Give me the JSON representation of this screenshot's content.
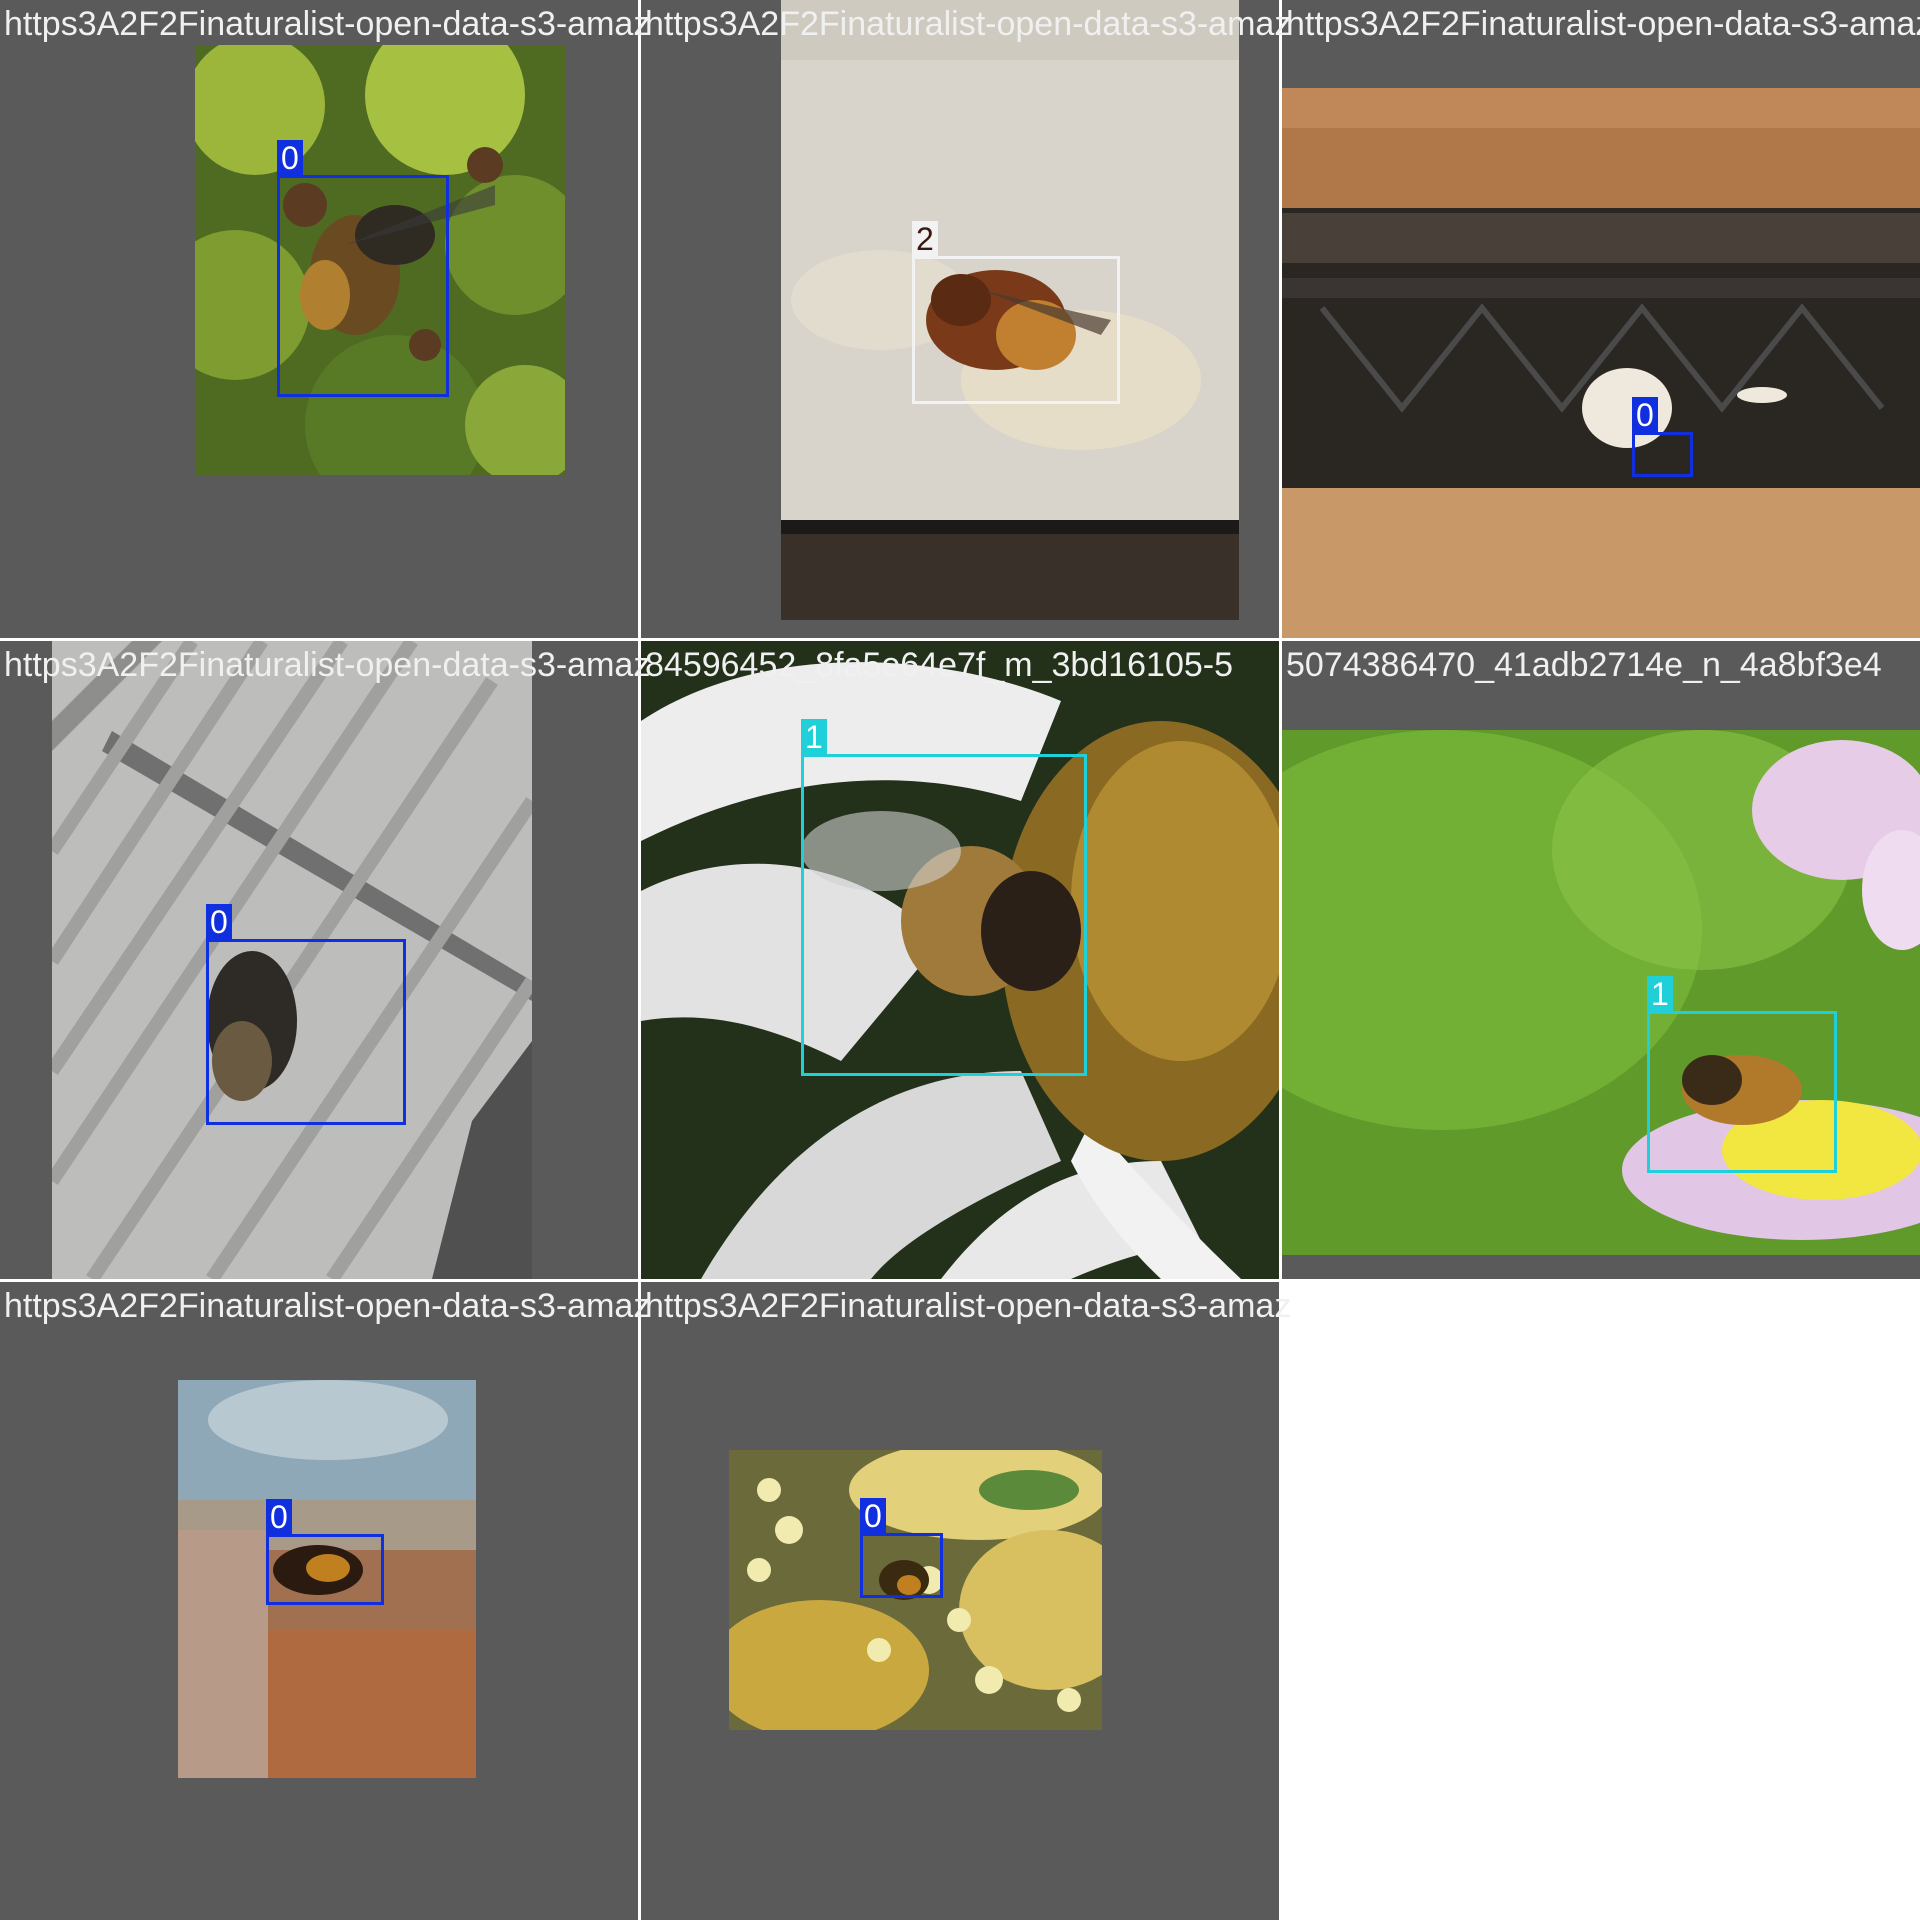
{
  "mosaic": {
    "tiles": [
      {
        "caption": "https3A2F2Finaturalist-open-data-s3-amaz",
        "detections": [
          {
            "class_label": "0"
          }
        ]
      },
      {
        "caption": "https3A2F2Finaturalist-open-data-s3-amaz",
        "detections": [
          {
            "class_label": "2"
          }
        ]
      },
      {
        "caption": "https3A2F2Finaturalist-open-data-s3-amaz",
        "detections": [
          {
            "class_label": "0"
          }
        ]
      },
      {
        "caption": "https3A2F2Finaturalist-open-data-s3-amaz",
        "detections": [
          {
            "class_label": "0"
          }
        ]
      },
      {
        "caption": "84596452_8fa5e64e7f_m_3bd16105-5",
        "detections": [
          {
            "class_label": "1"
          }
        ]
      },
      {
        "caption": "5074386470_41adb2714e_n_4a8bf3e4",
        "detections": [
          {
            "class_label": "1"
          }
        ]
      },
      {
        "caption": "https3A2F2Finaturalist-open-data-s3-amaz",
        "detections": [
          {
            "class_label": "0"
          }
        ]
      },
      {
        "caption": "https3A2F2Finaturalist-open-data-s3-amaz",
        "detections": [
          {
            "class_label": "0"
          }
        ]
      }
    ]
  },
  "colors": {
    "class_0": "#1030e0",
    "class_1": "#20d0d8",
    "class_2": "#f2f2f2",
    "tile_background": "#5a5a5a"
  }
}
